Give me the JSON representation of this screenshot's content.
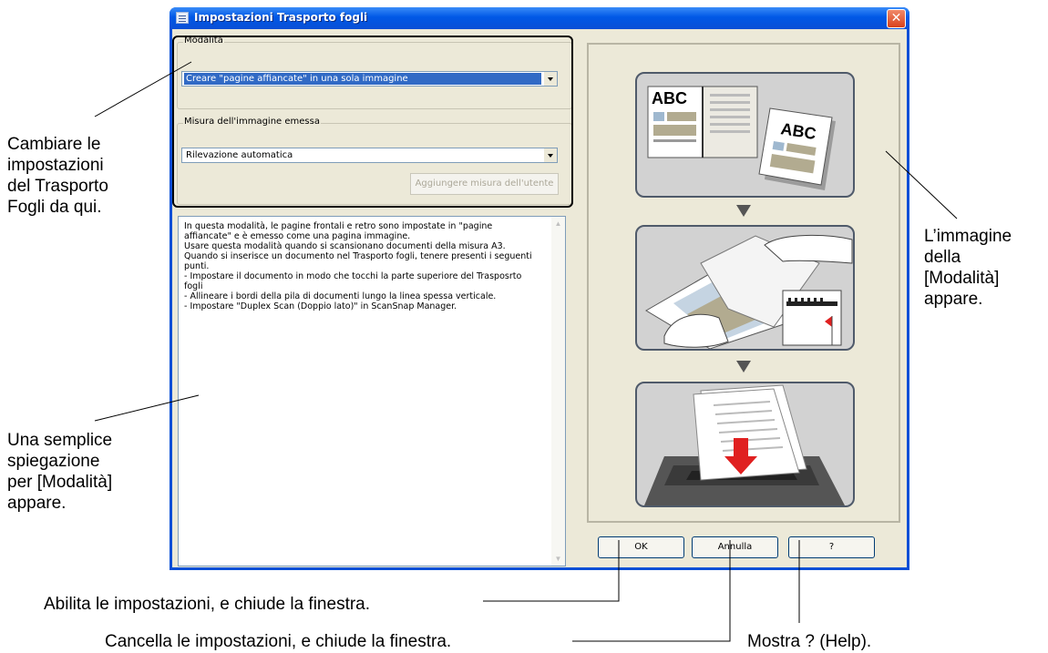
{
  "window": {
    "title": "Impostazioni Trasporto fogli",
    "close_glyph": "✕"
  },
  "modalita": {
    "label": "Modalità",
    "selected": "Creare \"pagine affiancate\" in una sola immagine"
  },
  "misura": {
    "label": "Misura dell'immagine emessa",
    "selected": "Rilevazione automatica",
    "add_button": "Aggiungere misura dell'utente"
  },
  "description": [
    "In questa modalità, le pagine frontali e retro sono impostate in \"pagine affiancate\" e è emesso come una pagina immagine.",
    " Usare questa modalità quando si scansionano documenti della misura A3.",
    "",
    " Quando si inserisce un documento nel Trasporto fogli, tenere presenti i seguenti punti.",
    "",
    " - Impostare il documento in modo che tocchi la parte superiore del Trasposrto fogli",
    " - Allineare i bordi della pila di documenti lungo la linea spessa verticale.",
    "",
    "- Impostare \"Duplex Scan (Doppio lato)\" in ScanSnap Manager."
  ],
  "illustration": {
    "text_abc": "ABC"
  },
  "buttons": {
    "ok": "OK",
    "cancel": "Annulla",
    "help": "?"
  },
  "callouts": {
    "change_settings": [
      "Cambiare le",
      "impostazioni",
      "del Trasporto",
      "Fogli da qui."
    ],
    "simple_explanation": [
      "Una semplice",
      "spiegazione",
      "per [Modalità]",
      "appare."
    ],
    "image_appears": [
      "L’immagine",
      "della",
      "[Modalità]",
      "appare."
    ],
    "ok_desc": "Abilita le impostazioni, e chiude la finestra.",
    "cancel_desc": "Cancella le impostazioni, e chiude la finestra.",
    "help_desc": "Mostra ? (Help)."
  },
  "colors": {
    "title_blue": "#0a4fd6",
    "selection": "#316ac5",
    "dialog_bg": "#ece9d8",
    "close_red": "#d9411c"
  }
}
